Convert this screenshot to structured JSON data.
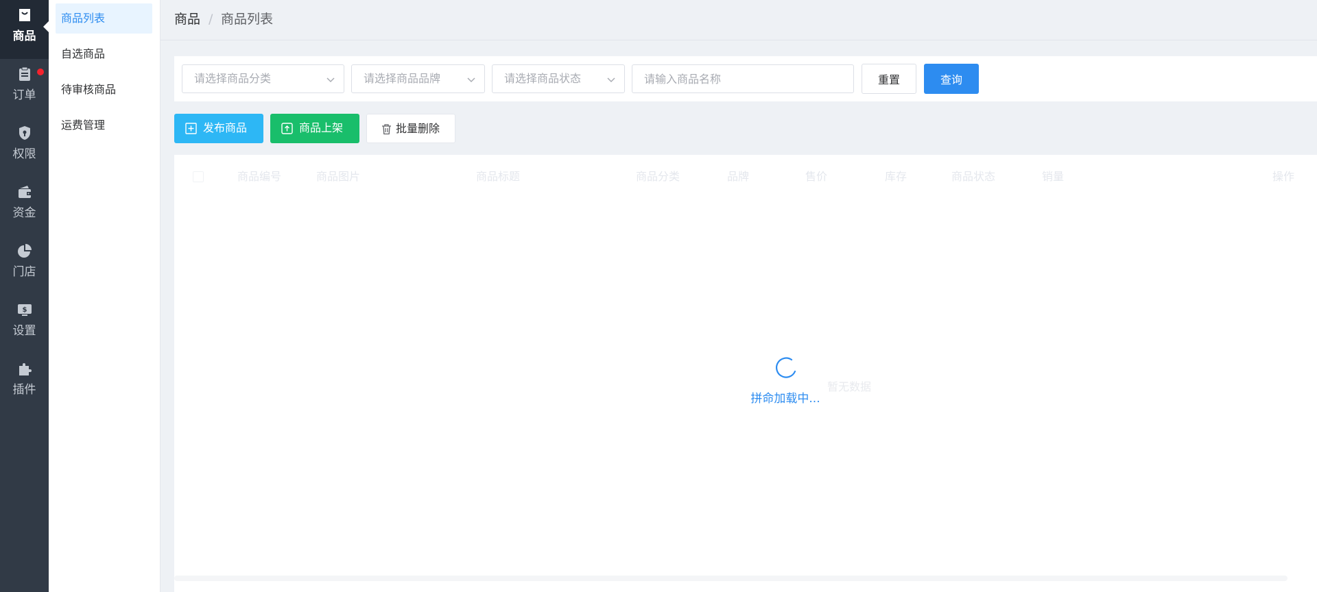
{
  "rail": {
    "items": [
      {
        "label": "商品",
        "icon": "shopping-bag-icon"
      },
      {
        "label": "订单",
        "icon": "clipboard-icon"
      },
      {
        "label": "权限",
        "icon": "shield-lock-icon"
      },
      {
        "label": "资金",
        "icon": "wallet-icon"
      },
      {
        "label": "门店",
        "icon": "pie-chart-icon"
      },
      {
        "label": "设置",
        "icon": "dollar-card-icon"
      },
      {
        "label": "插件",
        "icon": "puzzle-icon"
      }
    ]
  },
  "subnav": {
    "items": [
      {
        "label": "商品列表"
      },
      {
        "label": "自选商品"
      },
      {
        "label": "待审核商品"
      },
      {
        "label": "运费管理"
      }
    ]
  },
  "breadcrumb": {
    "root": "商品",
    "separator": "/",
    "current": "商品列表"
  },
  "filters": {
    "category_placeholder": "请选择商品分类",
    "brand_placeholder": "请选择商品品牌",
    "status_placeholder": "请选择商品状态",
    "name_placeholder": "请输入商品名称",
    "reset_label": "重置",
    "query_label": "查询"
  },
  "actions": {
    "publish_label": "发布商品",
    "shelf_label": "商品上架",
    "delete_label": "批量删除"
  },
  "table": {
    "columns": [
      "商品编号",
      "商品图片",
      "商品标题",
      "商品分类",
      "品牌",
      "售价",
      "库存",
      "商品状态",
      "销量",
      "操作"
    ],
    "empty_text": "暂无数据",
    "loading_text": "拼命加载中..."
  },
  "colors": {
    "primary": "#2d8cf0",
    "info": "#2db7f5",
    "success": "#19be6b",
    "sidebar": "#313a46"
  }
}
